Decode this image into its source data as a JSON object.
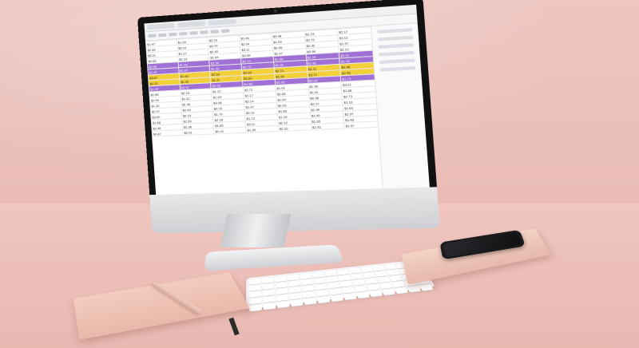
{
  "scene": {
    "description_tags": [
      "desk",
      "monitor",
      "spreadsheet",
      "keyboard",
      "notebook",
      "phone",
      "pen"
    ],
    "colors": {
      "wall": "#eec7c1",
      "desk": "#ecc0b9",
      "highlight_purple": "#a070d6",
      "highlight_yellow": "#f3cf3a"
    }
  },
  "spreadsheet": {
    "rows": [
      [
        "$1.97",
        "$1.09",
        "$2.19",
        "$1.45",
        "$3.98",
        "$1.23",
        "$2.12"
      ],
      [
        "$2.34",
        "$3.10",
        "$0.79",
        "$2.04",
        "$1.63",
        "$2.72",
        "$3.12"
      ],
      [
        "$3.21",
        "$1.27",
        "$2.40",
        "$3.11",
        "$0.55",
        "$2.42",
        "$1.37"
      ],
      [
        "$0.68",
        "$2.23",
        "$1.89",
        "$3.99",
        "$1.47",
        "$0.98",
        "$2.10"
      ],
      [
        "$2.08",
        "$1.59",
        "$3.54",
        "$1.10",
        "$1.58",
        "$1.93",
        "$2.31"
      ],
      [
        "$1.44",
        "$2.97",
        "$1.04",
        "$2.72",
        "$3.30",
        "$2.80",
        "$1.15"
      ],
      [
        "$3.67",
        "$1.48",
        "$2.63",
        "$0.93",
        "$2.21",
        "$1.21",
        "$0.98"
      ],
      [
        "$2.13",
        "$2.40",
        "$1.37",
        "$3.60",
        "$1.90",
        "$3.12",
        "$2.36"
      ],
      [
        "$1.28",
        "$3.31",
        "$2.03",
        "$1.88",
        "$2.45",
        "$2.03",
        "$1.71"
      ],
      [
        "$0.98",
        "$2.15",
        "$1.22",
        "$2.71",
        "$1.01",
        "$1.95",
        "$3.21"
      ],
      [
        "$2.99",
        "$1.42",
        "$1.63",
        "$1.17",
        "$2.83",
        "$2.41",
        "$1.86"
      ],
      [
        "$1.32",
        "$1.45",
        "$3.46",
        "$2.14",
        "$1.64",
        "$0.98",
        "$2.73"
      ],
      [
        "$2.37",
        "$0.49",
        "$2.16",
        "$1.47",
        "$2.03",
        "$2.17",
        "$1.10"
      ],
      [
        "$3.00",
        "$2.23",
        "$1.79",
        "$2.19",
        "$1.89",
        "$1.49",
        "$1.83"
      ],
      [
        "$1.88",
        "$1.89",
        "$2.28",
        "$1.72",
        "$1.29",
        "$2.49",
        "$2.07"
      ],
      [
        "$2.46",
        "$1.36",
        "$1.60",
        "$3.11",
        "$2.12",
        "$1.65",
        "$1.48"
      ],
      [
        "$0.87",
        "$2.01",
        "$2.41",
        "$1.39",
        "$2.32",
        "$2.33",
        "$1.97"
      ]
    ],
    "highlighted_rows": {
      "purple": [
        4,
        5,
        8
      ],
      "yellow": [
        6,
        7
      ]
    }
  }
}
